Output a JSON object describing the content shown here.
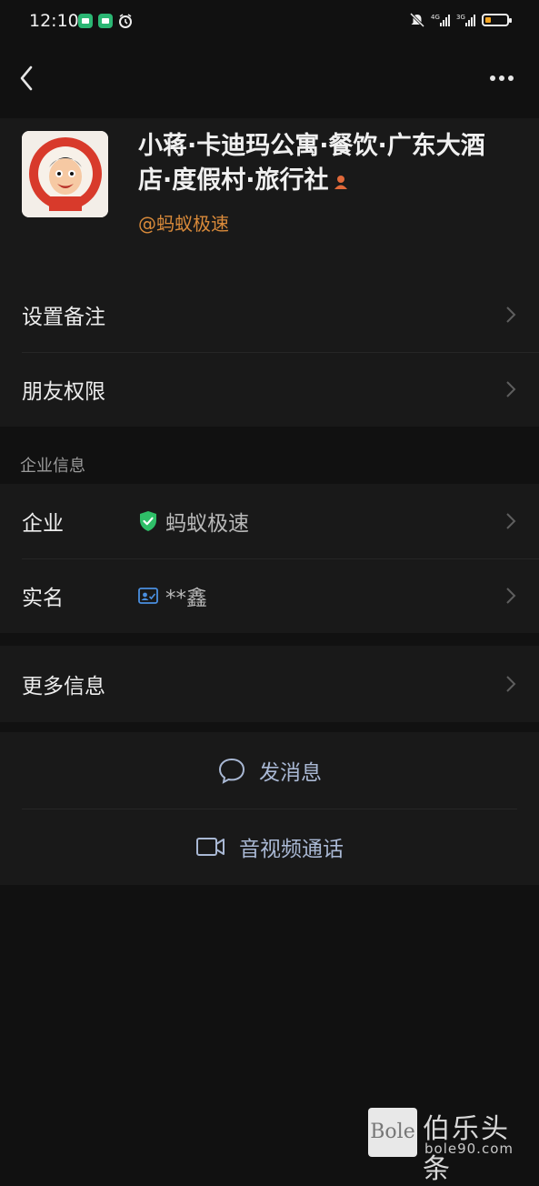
{
  "status_bar": {
    "time": "12:10"
  },
  "profile": {
    "name": "小蒋·卡迪玛公寓·餐饮·广东大酒店·度假村·旅行社",
    "handle": "@蚂蚁极速",
    "name_icon": "person-orange-icon",
    "handle_color": "#d98a3a"
  },
  "settings": {
    "items": [
      {
        "label": "设置备注"
      },
      {
        "label": "朋友权限"
      }
    ]
  },
  "enterprise": {
    "section_title": "企业信息",
    "rows": [
      {
        "label": "企业",
        "value": "蚂蚁极速",
        "icon": "verified-shield-icon"
      },
      {
        "label": "实名",
        "value": "**鑫",
        "icon": "id-card-icon"
      }
    ]
  },
  "more": {
    "label": "更多信息"
  },
  "actions": {
    "message": "发消息",
    "call": "音视频通话",
    "accent": "#a9b8d4"
  },
  "watermark": {
    "logo_text": "Bole",
    "brand": "伯乐头条",
    "url": "bole90.com"
  }
}
